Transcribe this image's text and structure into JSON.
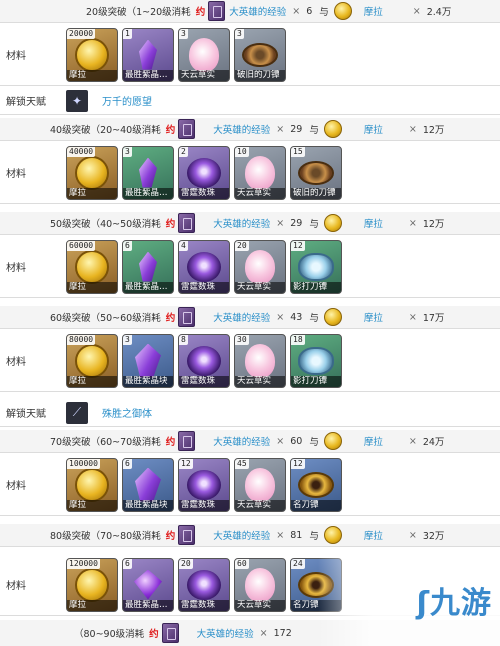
{
  "sections": [
    {
      "title": "20级突破（1~20级消耗",
      "exp_count": "6",
      "mora_count": "2.4万"
    },
    {
      "title": "40级突破（20~40级消耗",
      "exp_count": "29",
      "mora_count": "12万"
    },
    {
      "title": "50级突破（40~50级消耗",
      "exp_count": "29",
      "mora_count": "12万"
    },
    {
      "title": "60级突破（50~60级消耗",
      "exp_count": "43",
      "mora_count": "17万"
    },
    {
      "title": "70级突破（60~70级消耗",
      "exp_count": "60",
      "mora_count": "24万"
    },
    {
      "title": "80级突破（70~80级消耗",
      "exp_count": "81",
      "mora_count": "32万"
    },
    {
      "title": "（80~90级消耗",
      "exp_count": "172",
      "mora_count": ""
    }
  ],
  "labels": {
    "yue": "约",
    "exp_name": "大英雄的经验",
    "times": "×",
    "with": "与",
    "mora_name": "摩拉",
    "materials": "材料",
    "unlock_talent": "解锁天赋"
  },
  "materials": [
    [
      {
        "count": "20000",
        "name": "摩拉",
        "icon": "mora-coin-icon",
        "quality": "q5"
      },
      {
        "count": "1",
        "name": "最胜紫晶…",
        "icon": "crystal-icon",
        "quality": "q4"
      },
      {
        "count": "3",
        "name": "天云草实",
        "icon": "flower-icon",
        "quality": "q1"
      },
      {
        "count": "3",
        "name": "破旧的刀镡",
        "icon": "tsuba-icon",
        "quality": "q1"
      }
    ],
    [
      {
        "count": "40000",
        "name": "摩拉",
        "icon": "mora-coin-icon",
        "quality": "q5"
      },
      {
        "count": "3",
        "name": "最胜紫晶…",
        "icon": "crystal-icon",
        "quality": "q2"
      },
      {
        "count": "2",
        "name": "雷霆数珠",
        "icon": "pearl-icon",
        "quality": "q4"
      },
      {
        "count": "10",
        "name": "天云草实",
        "icon": "flower-icon",
        "quality": "q1"
      },
      {
        "count": "15",
        "name": "破旧的刀镡",
        "icon": "tsuba-icon",
        "quality": "q1"
      }
    ],
    [
      {
        "count": "60000",
        "name": "摩拉",
        "icon": "mora-coin-icon",
        "quality": "q5"
      },
      {
        "count": "6",
        "name": "最胜紫晶…",
        "icon": "crystal-icon",
        "quality": "q2"
      },
      {
        "count": "4",
        "name": "雷霆数珠",
        "icon": "pearl-icon",
        "quality": "q4"
      },
      {
        "count": "20",
        "name": "天云草实",
        "icon": "flower-icon",
        "quality": "q1"
      },
      {
        "count": "12",
        "name": "影打刀镡",
        "icon": "tsuba-blue-icon",
        "quality": "q2"
      }
    ],
    [
      {
        "count": "80000",
        "name": "摩拉",
        "icon": "mora-coin-icon",
        "quality": "q5"
      },
      {
        "count": "3",
        "name": "最胜紫晶块",
        "icon": "crystal-big-icon",
        "quality": "q3"
      },
      {
        "count": "8",
        "name": "雷霆数珠",
        "icon": "pearl-icon",
        "quality": "q4"
      },
      {
        "count": "30",
        "name": "天云草实",
        "icon": "flower-icon",
        "quality": "q1"
      },
      {
        "count": "18",
        "name": "影打刀镡",
        "icon": "tsuba-blue-icon",
        "quality": "q2"
      }
    ],
    [
      {
        "count": "100000",
        "name": "摩拉",
        "icon": "mora-coin-icon",
        "quality": "q5"
      },
      {
        "count": "6",
        "name": "最胜紫晶块",
        "icon": "crystal-big-icon",
        "quality": "q3"
      },
      {
        "count": "12",
        "name": "雷霆数珠",
        "icon": "pearl-icon",
        "quality": "q4"
      },
      {
        "count": "45",
        "name": "天云草实",
        "icon": "flower-icon",
        "quality": "q1"
      },
      {
        "count": "12",
        "name": "名刀镡",
        "icon": "tsuba-gold-icon",
        "quality": "q3"
      }
    ],
    [
      {
        "count": "120000",
        "name": "摩拉",
        "icon": "mora-coin-icon",
        "quality": "q5"
      },
      {
        "count": "6",
        "name": "最胜紫晶…",
        "icon": "gem-icon",
        "quality": "q4"
      },
      {
        "count": "20",
        "name": "雷霆数珠",
        "icon": "pearl-icon",
        "quality": "q4"
      },
      {
        "count": "60",
        "name": "天云草实",
        "icon": "flower-icon",
        "quality": "q1"
      },
      {
        "count": "24",
        "name": "名刀镡",
        "icon": "tsuba-gold-icon",
        "quality": "q3"
      }
    ]
  ],
  "talents": [
    {
      "name": "万千的愿望",
      "icon": "sparkle-icon"
    },
    {
      "name": "殊胜之御体",
      "icon": "blade-icon"
    }
  ],
  "watermark": "九游"
}
